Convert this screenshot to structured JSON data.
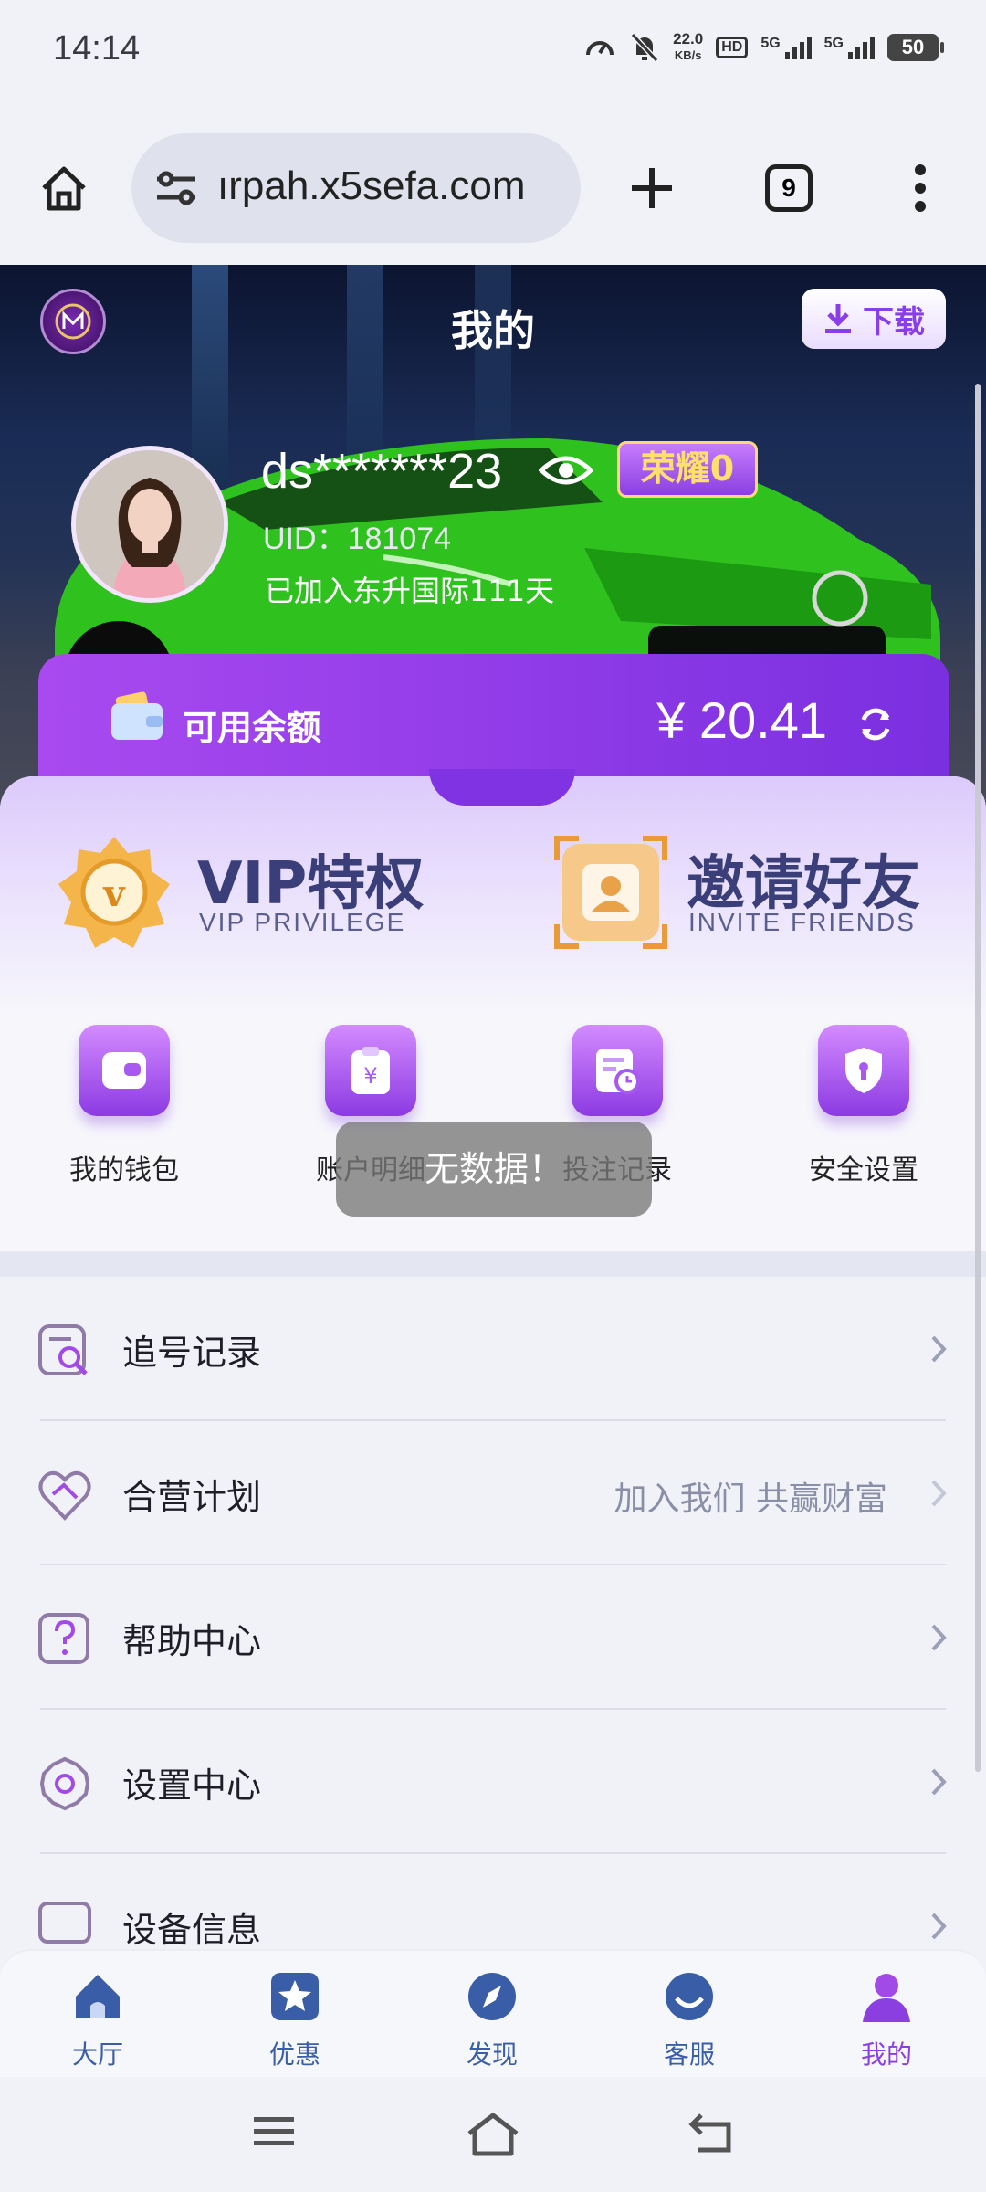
{
  "status_bar": {
    "time": "14:14",
    "net_speed_value": "22.0",
    "net_speed_unit": "KB/s",
    "hd_label": "HD",
    "sim1_label": "5G",
    "sim2_label": "5G",
    "battery": "50"
  },
  "browser": {
    "url": "ırpah.x5sefa.com",
    "tab_count": "9"
  },
  "header": {
    "title": "我的",
    "download_label": "下载"
  },
  "profile": {
    "username": "ds*******23",
    "honor_badge": "荣耀0",
    "uid": "UID：181074",
    "joined_text": "已加入东升国际111天"
  },
  "balance": {
    "label": "可用余额",
    "amount": "¥ 20.41"
  },
  "features": [
    {
      "title": "VIP特权",
      "subtitle": "VIP PRIVILEGE",
      "icon": "vip-medal-icon"
    },
    {
      "title": "邀请好友",
      "subtitle": "INVITE FRIENDS",
      "icon": "invite-card-icon"
    }
  ],
  "quick_actions": [
    {
      "label": "我的钱包",
      "icon": "wallet-icon"
    },
    {
      "label": "账户明细",
      "icon": "clipboard-yen-icon"
    },
    {
      "label": "投注记录",
      "icon": "bet-record-icon"
    },
    {
      "label": "安全设置",
      "icon": "shield-icon"
    }
  ],
  "toast": "无数据！",
  "menu": [
    {
      "label": "追号记录",
      "hint": "",
      "icon": "search-list-icon"
    },
    {
      "label": "合营计划",
      "hint": "加入我们 共赢财富",
      "icon": "handshake-heart-icon"
    },
    {
      "label": "帮助中心",
      "hint": "",
      "icon": "help-icon"
    },
    {
      "label": "设置中心",
      "hint": "",
      "icon": "gear-icon"
    },
    {
      "label": "设备信息",
      "hint": "",
      "icon": "device-icon"
    }
  ],
  "bottom_nav": [
    {
      "label": "大厅",
      "icon": "home-icon",
      "active": false
    },
    {
      "label": "优惠",
      "icon": "star-icon",
      "active": false
    },
    {
      "label": "发现",
      "icon": "compass-icon",
      "active": false
    },
    {
      "label": "客服",
      "icon": "smile-icon",
      "active": false
    },
    {
      "label": "我的",
      "icon": "user-icon",
      "active": true
    }
  ],
  "colors": {
    "accent": "#8b3fe0",
    "nav_inactive": "#3a5da8",
    "nav_active": "#8b3fe0"
  }
}
